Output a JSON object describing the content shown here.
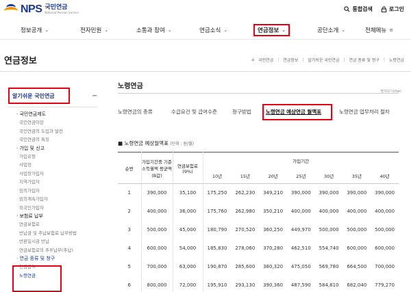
{
  "logo": {
    "mark": "NPS",
    "name_ko": "국민연금",
    "name_en": "National Pension Service"
  },
  "util": {
    "search": "통합검색",
    "login": "로그인"
  },
  "gnb": [
    "정보공개",
    "전자민원",
    "소통과 참여",
    "연금소식",
    "연금정보",
    "공단소개",
    "전체메뉴"
  ],
  "page_title": "연금정보",
  "breadcrumb": [
    "국민연금",
    "연금정보",
    "알기쉬운 국민연금",
    "연금 종류 및 청구",
    "노령연금"
  ],
  "sidebar": {
    "title": "알기쉬운 국민연금",
    "toggle": "−",
    "groups": [
      {
        "label": "국민연금제도",
        "items": [
          "국민연금이란",
          "국민연금의 도입과 발전",
          "국민연금의 특징"
        ]
      },
      {
        "label": "가입 및 신고",
        "items": [
          "가입유형",
          "사업장",
          "사업장가입자",
          "지역가입자",
          "임의가입자",
          "임의계속가입자",
          "외국인가입자"
        ]
      },
      {
        "label": "보험료 납부",
        "items": [
          "연금보험료",
          "반납금 및 추납보험료 납부방법",
          "반환일시금 반납",
          "연금보험료의 추후납부(추납)"
        ]
      },
      {
        "label": "연금 종류 및 청구",
        "items": [
          "연금급여",
          "노령연금"
        ]
      }
    ]
  },
  "main": {
    "title": "노령연금",
    "collapse": "펼쳐보기(8㎜)",
    "tabs": [
      "노령연금의 종류",
      "수급요건 및 급여수준",
      "청구방법",
      "노령연금 예상연금 월액표",
      "노령연금 업무처리 절차"
    ],
    "active_tab": 3,
    "table_title": "노령연금 예상월액표",
    "table_unit": "(단위 : 원/월)",
    "headers": {
      "no": "순번",
      "income": "가입기간중 기준 소득월액 평균액(B값)",
      "premium": "연금보험료 (9%)",
      "period": "가입기간",
      "years": [
        "10년",
        "15년",
        "20년",
        "25년",
        "30년",
        "35년",
        "40년"
      ]
    },
    "rows": [
      [
        "1",
        "390,000",
        "35,100",
        "175,250",
        "262,230",
        "349,210",
        "390,000",
        "390,000",
        "390,000",
        "390,000"
      ],
      [
        "2",
        "400,000",
        "36,000",
        "175,760",
        "262,980",
        "350,210",
        "400,000",
        "400,000",
        "400,000",
        "400,000"
      ],
      [
        "3",
        "500,000",
        "45,000",
        "180,790",
        "270,520",
        "360,250",
        "449,970",
        "500,000",
        "500,000",
        "500,000"
      ],
      [
        "4",
        "600,000",
        "54,000",
        "185,830",
        "278,060",
        "370,280",
        "462,510",
        "554,740",
        "600,000",
        "600,000"
      ],
      [
        "5",
        "700,000",
        "63,000",
        "190,870",
        "285,600",
        "380,320",
        "475,050",
        "569,780",
        "664,500",
        "700,000"
      ],
      [
        "6",
        "800,000",
        "72,000",
        "195,910",
        "293,130",
        "390,360",
        "487,590",
        "584,810",
        "682,040",
        "779,270"
      ]
    ]
  },
  "colors": {
    "brand_blue": "#1b3a8f",
    "brand_orange": "#f39800",
    "highlight": "#e60012"
  }
}
